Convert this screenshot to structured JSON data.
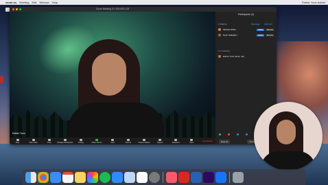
{
  "menubar": {
    "app": "zoom.us",
    "items": [
      "Meeting",
      "Edit",
      "Window",
      "Help"
    ],
    "right_text": "Esther Yoon Admin"
  },
  "window": {
    "title": "Zoom Meeting ID: 000-829-118"
  },
  "video": {
    "speaker_name": "Esther Yoon"
  },
  "toolbar": {
    "buttons": [
      "Mute",
      "Stop Video",
      "Invite",
      "Manage Participants",
      "Polling",
      "Share Screen",
      "Chat",
      "Record",
      "Closed Caption",
      "Support",
      "Reactions",
      "More",
      "End Meeting"
    ]
  },
  "participants": {
    "title": "Participants (3)",
    "waiting_label": "2 Waiting",
    "message_label": "Message",
    "admit_all_label": "Admit all",
    "waiting": [
      {
        "name": "Michael White",
        "admit": "Admit",
        "remove": "Remove"
      },
      {
        "name": "Ryan Gallagher",
        "admit": "Admit",
        "remove": "Remove"
      }
    ],
    "in_meeting_label": "1 In-meeting",
    "in_meeting": [
      {
        "name": "Esther Yoon (Host, me)"
      }
    ],
    "mute_all": "Mute All",
    "unmute_all": "Unmute All"
  },
  "colors": {
    "accent": "#2d7ff9",
    "end_meeting": "#ff4a4a",
    "panel_bg": "#232323"
  },
  "dock": {
    "apps": [
      "finder-icon",
      "chrome-icon",
      "mail-icon",
      "calendar-icon",
      "notes-icon",
      "photos-icon",
      "spotify-icon",
      "zoom-icon",
      "preview-icon",
      "slack-icon",
      "settings-icon",
      "music-icon",
      "acrobat-icon",
      "word-icon",
      "premiere-icon",
      "xcode-icon",
      "trash-icon"
    ]
  }
}
